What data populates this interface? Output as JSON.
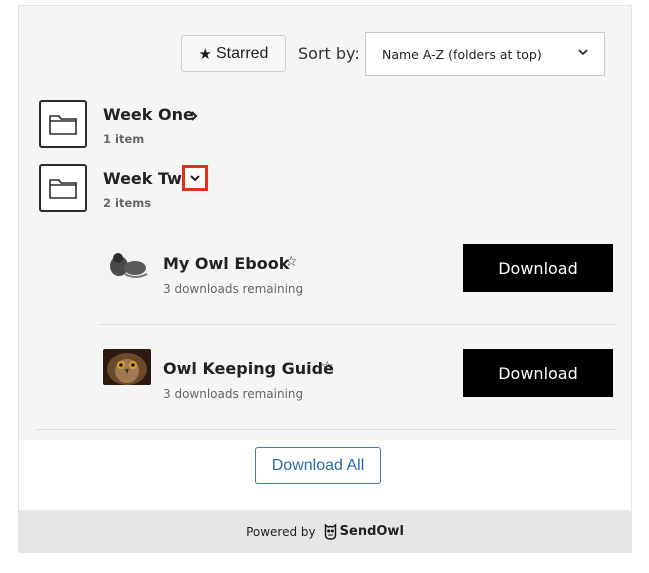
{
  "toolbar": {
    "starred_label": "Starred",
    "sort_label": "Sort by:",
    "sort_value": "Name A-Z (folders at top)"
  },
  "folders": [
    {
      "name": "Week One",
      "count": "1 item"
    },
    {
      "name": "Week Two",
      "count": "2 items"
    }
  ],
  "items": [
    {
      "title": "My Owl Ebook",
      "remaining": "3 downloads remaining",
      "download_label": "Download"
    },
    {
      "title": "Owl Keeping Guide",
      "remaining": "3 downloads remaining",
      "download_label": "Download"
    }
  ],
  "download_all_label": "Download All",
  "footer": {
    "powered_by": "Powered by",
    "brand": "SendOwl"
  },
  "icons": {
    "starred": "star-filled-icon",
    "item_star": "star-outline-icon",
    "folder": "folder-icon",
    "expand": "chevron-right-icon",
    "collapse": "chevron-down-icon",
    "sort": "chevron-down-icon",
    "brand": "owl-logo-icon"
  },
  "colors": {
    "download_button": "#000000",
    "download_all_border": "#3d7ab6",
    "highlight_box": "#e0321e",
    "footer_bg": "#e6e6e6"
  }
}
